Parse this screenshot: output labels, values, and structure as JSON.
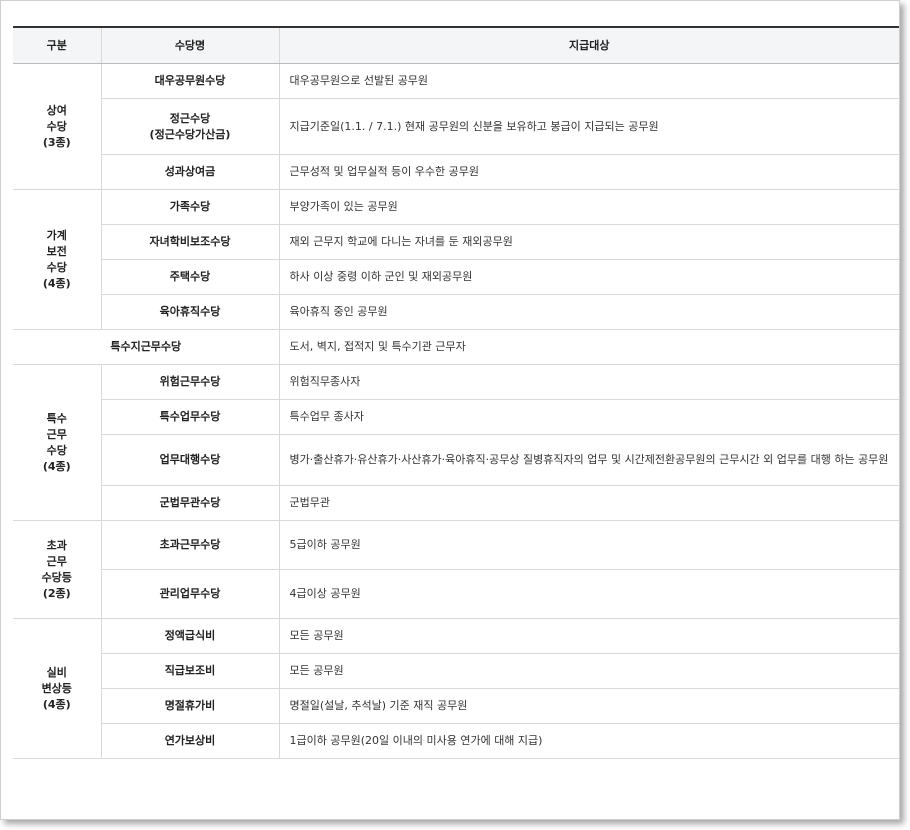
{
  "header": {
    "col1": "구분",
    "col2": "수당명",
    "col3": "지급대상"
  },
  "groups": [
    {
      "label": [
        "상여",
        "수당",
        "(3종)"
      ]
    },
    {
      "label": [
        "가계",
        "보전",
        "수당",
        "(4종)"
      ]
    },
    {
      "label": [
        "특수지근무수당"
      ]
    },
    {
      "label": [
        "특수",
        "근무",
        "수당",
        "(4종)"
      ]
    },
    {
      "label": [
        "초과",
        "근무",
        "수당등",
        "(2종)"
      ]
    },
    {
      "label": [
        "실비",
        "변상등",
        "(4종)"
      ]
    }
  ],
  "rows": [
    {
      "name": [
        "대우공무원수당"
      ],
      "target": "대우공무원으로 선발된 공무원"
    },
    {
      "name": [
        "정근수당",
        "(정근수당가산금)"
      ],
      "target": "지급기준일(1.1. / 7.1.) 현재 공무원의 신분을 보유하고 봉급이 지급되는 공무원"
    },
    {
      "name": [
        "성과상여금"
      ],
      "target": "근무성적 및 업무실적 등이 우수한 공무원"
    },
    {
      "name": [
        "가족수당"
      ],
      "target": "부양가족이 있는 공무원"
    },
    {
      "name": [
        "자녀학비보조수당"
      ],
      "target": "재외 근무지 학교에 다니는 자녀를 둔 재외공무원"
    },
    {
      "name": [
        "주택수당"
      ],
      "target": "하사 이상 중령 이하 군인 및 재외공무원"
    },
    {
      "name": [
        "육아휴직수당"
      ],
      "target": "육아휴직 중인 공무원"
    },
    {
      "name": [],
      "target": "도서, 벽지, 접적지 및 특수기관 근무자"
    },
    {
      "name": [
        "위험근무수당"
      ],
      "target": "위험직무종사자"
    },
    {
      "name": [
        "특수업무수당"
      ],
      "target": "특수업무 종사자"
    },
    {
      "name": [
        "업무대행수당"
      ],
      "target": "병가·출산휴가·유산휴가·사산휴가·육아휴직·공무상 질병휴직자의 업무 및 시간제전환공무원의 근무시간 외 업무를 대행 하는 공무원"
    },
    {
      "name": [
        "군법무관수당"
      ],
      "target": "군법무관"
    },
    {
      "name": [
        "초과근무수당"
      ],
      "target": "5급이하 공무원"
    },
    {
      "name": [
        "관리업무수당"
      ],
      "target": "4급이상 공무원"
    },
    {
      "name": [
        "정액급식비"
      ],
      "target": "모든 공무원"
    },
    {
      "name": [
        "직급보조비"
      ],
      "target": "모든 공무원"
    },
    {
      "name": [
        "명절휴가비"
      ],
      "target": "명절일(설날, 추석날) 기준 재직 공무원"
    },
    {
      "name": [
        "연가보상비"
      ],
      "target": "1급이하 공무원(20일 이내의 미사용 연가에 대해 지급)"
    }
  ]
}
